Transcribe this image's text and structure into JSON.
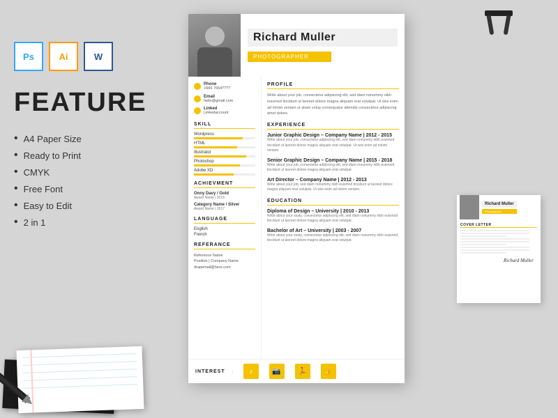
{
  "page": {
    "background_color": "#d5d5d5"
  },
  "software_icons": [
    {
      "id": "ps",
      "label": "Ps",
      "class": "ps"
    },
    {
      "id": "ai",
      "label": "Ai",
      "class": "ai"
    },
    {
      "id": "wd",
      "label": "W",
      "class": "wd"
    }
  ],
  "feature_section": {
    "title": "FEATURE",
    "items": [
      {
        "text": "A4 Paper Size"
      },
      {
        "text": "Ready to Print"
      },
      {
        "text": "CMYK"
      },
      {
        "text": "Free Font"
      },
      {
        "text": "Easy to Edit"
      },
      {
        "text": "2 in 1"
      }
    ]
  },
  "cv": {
    "name": "Richard Muller",
    "job_title": "Photographer",
    "contact": {
      "phone_label": "Phone",
      "phone_value": "+666 7654????",
      "email_label": "Email",
      "email_value": "hello@gmail.com",
      "linked_label": "Linked",
      "linked_value": "Linkedaccount"
    },
    "sections": {
      "skill_title": "SKILL",
      "skills": [
        {
          "name": "Wordpress",
          "pct": 80
        },
        {
          "name": "HTML",
          "pct": 70
        },
        {
          "name": "Illustrator",
          "pct": 85
        },
        {
          "name": "Photoshop",
          "pct": 75
        },
        {
          "name": "Adobe XD",
          "pct": 65
        }
      ],
      "achievement_title": "ACHIEVMENT",
      "achievements": [
        {
          "name": "Onny Davy / Gold",
          "year": "Award Name | 2015"
        },
        {
          "name": "Category Name / Silver",
          "year": "Award Name | 2017"
        }
      ],
      "language_title": "LANGUAGE",
      "languages": [
        "English",
        "French"
      ],
      "reference_title": "REFERANCE",
      "reference": {
        "name": "Reference Name",
        "company": "Position | Company Name",
        "email": "drapemail@here.com"
      },
      "profile_title": "PROFILE",
      "profile_text": "Write about your job, consectetur adipiscing elit, sed diam nonummy nibh euismod tincidunt ut laoreet dolore magna aliquam erat volutpat. Ut wisi enim ad minim veniam ut aliam volup consequatur attendis consectetur adipiscing amet dolore.",
      "experience_title": "EXPERIENCE",
      "experiences": [
        {
          "title": "Junior Graphic Design – Company Name | 2012 - 2015",
          "desc": "Write about your job, consectetur adipiscing elit, sed diam nonummy nibh euismod tincidunt ut laoreet dolore magna aliquam erat volutpat. Ut wisi enim ad minim veniam."
        },
        {
          "title": "Senior Graphic Design – Company Name | 2015 - 2018",
          "desc": "Write about your job, consectetur adipiscing elit, sed diam nonummy nibh euismod tincidunt ut laoreet dolore magna aliquam erat volutpat."
        },
        {
          "title": "Art Director – Company Name | 2012 - 2013",
          "desc": "Write about your job, sed diam nonummy nibh euismod tincidunt ut laoreet dolore magna aliquam erat volutpat. Ut wisi enim ad minim veniam."
        }
      ],
      "education_title": "EDUCATION",
      "education": [
        {
          "title": "Diploma of Design – University | 2010 - 2013",
          "desc": "Write about your study, consectetur adipiscing elit, sed diam nonummy nibh euismod tincidunt ut laoreet dolore magna aliquam erat volutpat."
        },
        {
          "title": "Bachelor of Art – University | 2003 - 2007",
          "desc": "Write about your study, consectetur adipiscing elit, sed diam nonummy nibh euismod tincidunt ut laoreet dolore magna aliquam erat volutpat."
        }
      ],
      "interest_title": "INTEREST",
      "interests": [
        "🎵",
        "📷",
        "🏃",
        "👍"
      ]
    }
  },
  "cover_letter": {
    "name": "Richard Muller",
    "title": "Photographer",
    "section_label": "COVER LETTER",
    "signature": "Richard Muller"
  }
}
